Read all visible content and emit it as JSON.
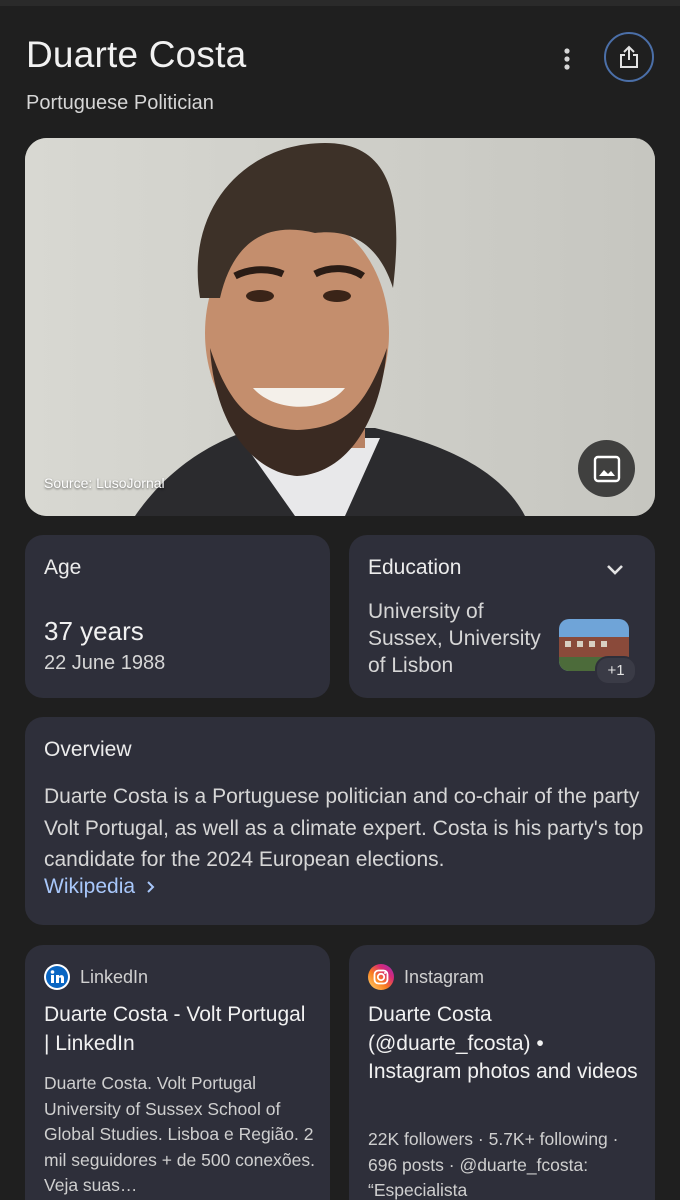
{
  "header": {
    "title": "Duarte Costa",
    "subtitle": "Portuguese Politician"
  },
  "photo": {
    "source": "Source: LusoJornal",
    "image_button_icon": "image-icon"
  },
  "age": {
    "label": "Age",
    "value": "37 years",
    "date": "22 June 1988"
  },
  "education": {
    "label": "Education",
    "text": "University of Sussex, University of Lisbon",
    "extra_count": "+1"
  },
  "overview": {
    "label": "Overview",
    "text": "Duarte Costa is a Portuguese politician and co-chair of the party Volt Portugal, as well as a climate expert. Costa is his party's top candidate for the 2024 European elections.",
    "link": "Wikipedia"
  },
  "results": [
    {
      "source": "LinkedIn",
      "title": "Duarte Costa - Volt Portugal | LinkedIn",
      "snippet": "Duarte Costa. Volt Portugal University of Sussex School of Global Studies. Lisboa e Região. 2 mil seguidores + de 500 conexões. Veja suas…"
    },
    {
      "source": "Instagram",
      "title": "Duarte Costa (@duarte_fcosta) • Instagram photos and videos",
      "snippet": "22K followers · 5.7K+ following · 696 posts · @duarte_fcosta: “Especialista"
    }
  ],
  "colors": {
    "background": "#1f1f1f",
    "card": "#2e2f3a",
    "link": "#a8c7fa",
    "share_ring": "#4b6fa8"
  }
}
